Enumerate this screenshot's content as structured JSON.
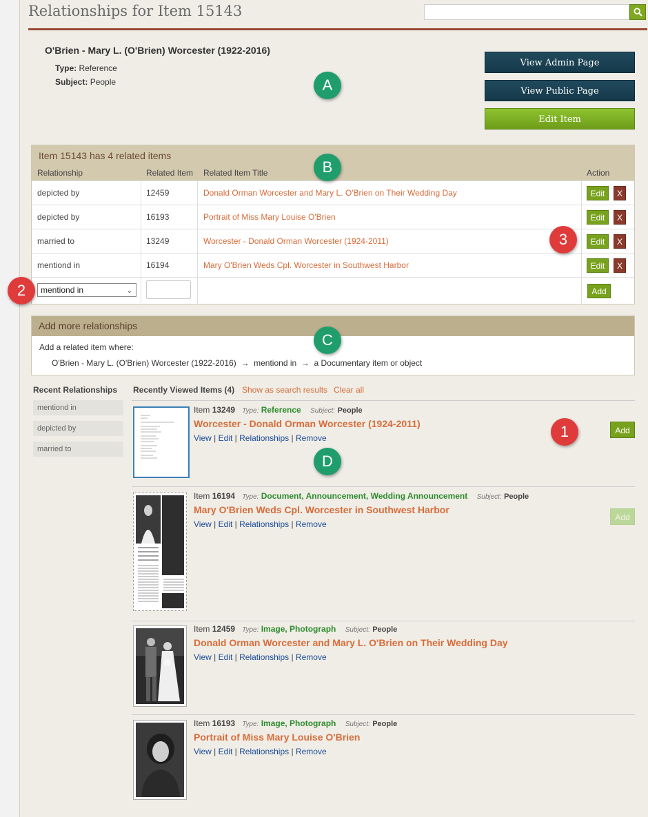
{
  "page": {
    "title": "Relationships for Item 15143",
    "search": {
      "placeholder": ""
    }
  },
  "item": {
    "name": "O'Brien - Mary L. (O'Brien) Worcester (1922-2016)",
    "type_label": "Type:",
    "type_value": "Reference",
    "subject_label": "Subject:",
    "subject_value": "People"
  },
  "buttons": {
    "view_admin": "View Admin Page",
    "view_public": "View Public Page",
    "edit_item": "Edit Item"
  },
  "callouts": {
    "a": "A",
    "b": "B",
    "c": "C",
    "d": "D",
    "one": "1",
    "two": "2",
    "three": "3"
  },
  "related": {
    "heading": "Item 15143 has 4 related items",
    "columns": {
      "relationship": "Relationship",
      "related_item": "Related Item",
      "title": "Related Item Title",
      "action": "Action"
    },
    "rows": [
      {
        "relationship": "depicted by",
        "id": "12459",
        "title": "Donald Orman Worcester and Mary L. O'Brien on Their Wedding Day"
      },
      {
        "relationship": "depicted by",
        "id": "16193",
        "title": "Portrait of Miss Mary Louise O'Brien"
      },
      {
        "relationship": "married to",
        "id": "13249",
        "title": "Worcester - Donald Orman Worcester (1924-2011)"
      },
      {
        "relationship": "mentiond in",
        "id": "16194",
        "title": "Mary O'Brien Weds Cpl. Worcester in Southwest Harbor"
      }
    ],
    "edit_label": "Edit",
    "delete_label": "X",
    "new_row": {
      "selected": "mentiond in",
      "id_value": "",
      "add_label": "Add"
    }
  },
  "more": {
    "heading": "Add more relationships",
    "intro": "Add a related item where:",
    "subject": "O'Brien - Mary L. (O'Brien) Worcester (1922-2016)",
    "arrow": "→",
    "relation": "mentiond in",
    "object": "a Documentary item or object"
  },
  "recent_relationships": {
    "title": "Recent Relationships",
    "items": [
      "mentiond in",
      "depicted by",
      "married to"
    ]
  },
  "recent_items": {
    "title": "Recently Viewed Items (4)",
    "show_results": "Show as search results",
    "clear_all": "Clear all",
    "type_label": "Type:",
    "subject_label": "Subject:",
    "item_prefix": "Item",
    "link_view": "View",
    "link_edit": "Edit",
    "link_relationships": "Relationships",
    "link_remove": "Remove",
    "sep": "|",
    "add_label": "Add",
    "entries": [
      {
        "id": "13249",
        "type": "Reference",
        "subject": "People",
        "title": "Worcester - Donald Orman Worcester (1924-2011)",
        "add_enabled": true
      },
      {
        "id": "16194",
        "type": "Document, Announcement, Wedding Announcement",
        "subject": "People",
        "title": "Mary O'Brien Weds Cpl. Worcester in Southwest Harbor",
        "add_enabled": false
      },
      {
        "id": "12459",
        "type": "Image, Photograph",
        "subject": "People",
        "title": "Donald Orman Worcester and Mary L. O'Brien on Their Wedding Day",
        "add_enabled": false
      },
      {
        "id": "16193",
        "type": "Image, Photograph",
        "subject": "People",
        "title": "Portrait of Miss Mary Louise O'Brien",
        "add_enabled": false
      }
    ]
  },
  "colors": {
    "accent_orange": "#d86c3a",
    "dark_button": "#1b4255",
    "green_button": "#78a21d",
    "header_tan": "#d3c9ae",
    "rule_red": "#9a4a32"
  }
}
